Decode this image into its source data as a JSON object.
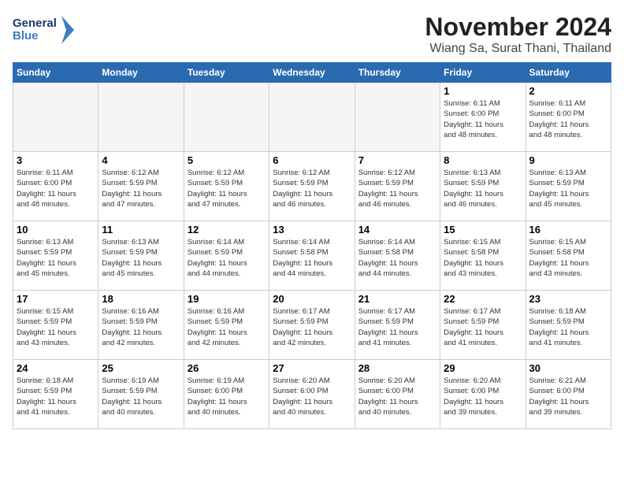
{
  "header": {
    "logo_line1": "General",
    "logo_line2": "Blue",
    "month": "November 2024",
    "location": "Wiang Sa, Surat Thani, Thailand"
  },
  "weekdays": [
    "Sunday",
    "Monday",
    "Tuesday",
    "Wednesday",
    "Thursday",
    "Friday",
    "Saturday"
  ],
  "weeks": [
    [
      {
        "day": "",
        "info": ""
      },
      {
        "day": "",
        "info": ""
      },
      {
        "day": "",
        "info": ""
      },
      {
        "day": "",
        "info": ""
      },
      {
        "day": "",
        "info": ""
      },
      {
        "day": "1",
        "info": "Sunrise: 6:11 AM\nSunset: 6:00 PM\nDaylight: 11 hours\nand 48 minutes."
      },
      {
        "day": "2",
        "info": "Sunrise: 6:11 AM\nSunset: 6:00 PM\nDaylight: 11 hours\nand 48 minutes."
      }
    ],
    [
      {
        "day": "3",
        "info": "Sunrise: 6:11 AM\nSunset: 6:00 PM\nDaylight: 11 hours\nand 48 minutes."
      },
      {
        "day": "4",
        "info": "Sunrise: 6:12 AM\nSunset: 5:59 PM\nDaylight: 11 hours\nand 47 minutes."
      },
      {
        "day": "5",
        "info": "Sunrise: 6:12 AM\nSunset: 5:59 PM\nDaylight: 11 hours\nand 47 minutes."
      },
      {
        "day": "6",
        "info": "Sunrise: 6:12 AM\nSunset: 5:59 PM\nDaylight: 11 hours\nand 46 minutes."
      },
      {
        "day": "7",
        "info": "Sunrise: 6:12 AM\nSunset: 5:59 PM\nDaylight: 11 hours\nand 46 minutes."
      },
      {
        "day": "8",
        "info": "Sunrise: 6:13 AM\nSunset: 5:59 PM\nDaylight: 11 hours\nand 46 minutes."
      },
      {
        "day": "9",
        "info": "Sunrise: 6:13 AM\nSunset: 5:59 PM\nDaylight: 11 hours\nand 45 minutes."
      }
    ],
    [
      {
        "day": "10",
        "info": "Sunrise: 6:13 AM\nSunset: 5:59 PM\nDaylight: 11 hours\nand 45 minutes."
      },
      {
        "day": "11",
        "info": "Sunrise: 6:13 AM\nSunset: 5:59 PM\nDaylight: 11 hours\nand 45 minutes."
      },
      {
        "day": "12",
        "info": "Sunrise: 6:14 AM\nSunset: 5:59 PM\nDaylight: 11 hours\nand 44 minutes."
      },
      {
        "day": "13",
        "info": "Sunrise: 6:14 AM\nSunset: 5:58 PM\nDaylight: 11 hours\nand 44 minutes."
      },
      {
        "day": "14",
        "info": "Sunrise: 6:14 AM\nSunset: 5:58 PM\nDaylight: 11 hours\nand 44 minutes."
      },
      {
        "day": "15",
        "info": "Sunrise: 6:15 AM\nSunset: 5:58 PM\nDaylight: 11 hours\nand 43 minutes."
      },
      {
        "day": "16",
        "info": "Sunrise: 6:15 AM\nSunset: 5:58 PM\nDaylight: 11 hours\nand 43 minutes."
      }
    ],
    [
      {
        "day": "17",
        "info": "Sunrise: 6:15 AM\nSunset: 5:59 PM\nDaylight: 11 hours\nand 43 minutes."
      },
      {
        "day": "18",
        "info": "Sunrise: 6:16 AM\nSunset: 5:59 PM\nDaylight: 11 hours\nand 42 minutes."
      },
      {
        "day": "19",
        "info": "Sunrise: 6:16 AM\nSunset: 5:59 PM\nDaylight: 11 hours\nand 42 minutes."
      },
      {
        "day": "20",
        "info": "Sunrise: 6:17 AM\nSunset: 5:59 PM\nDaylight: 11 hours\nand 42 minutes."
      },
      {
        "day": "21",
        "info": "Sunrise: 6:17 AM\nSunset: 5:59 PM\nDaylight: 11 hours\nand 41 minutes."
      },
      {
        "day": "22",
        "info": "Sunrise: 6:17 AM\nSunset: 5:59 PM\nDaylight: 11 hours\nand 41 minutes."
      },
      {
        "day": "23",
        "info": "Sunrise: 6:18 AM\nSunset: 5:59 PM\nDaylight: 11 hours\nand 41 minutes."
      }
    ],
    [
      {
        "day": "24",
        "info": "Sunrise: 6:18 AM\nSunset: 5:59 PM\nDaylight: 11 hours\nand 41 minutes."
      },
      {
        "day": "25",
        "info": "Sunrise: 6:19 AM\nSunset: 5:59 PM\nDaylight: 11 hours\nand 40 minutes."
      },
      {
        "day": "26",
        "info": "Sunrise: 6:19 AM\nSunset: 6:00 PM\nDaylight: 11 hours\nand 40 minutes."
      },
      {
        "day": "27",
        "info": "Sunrise: 6:20 AM\nSunset: 6:00 PM\nDaylight: 11 hours\nand 40 minutes."
      },
      {
        "day": "28",
        "info": "Sunrise: 6:20 AM\nSunset: 6:00 PM\nDaylight: 11 hours\nand 40 minutes."
      },
      {
        "day": "29",
        "info": "Sunrise: 6:20 AM\nSunset: 6:00 PM\nDaylight: 11 hours\nand 39 minutes."
      },
      {
        "day": "30",
        "info": "Sunrise: 6:21 AM\nSunset: 6:00 PM\nDaylight: 11 hours\nand 39 minutes."
      }
    ]
  ]
}
